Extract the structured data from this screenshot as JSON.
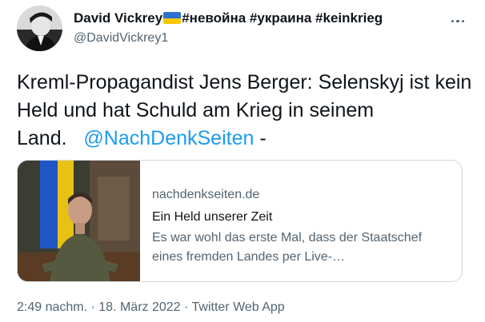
{
  "author": {
    "display_name": "David Vickrey",
    "display_name_suffix": "#невойна #украина #keinkrieg",
    "handle": "@DavidVickrey1",
    "avatar_icon": "profile-photo",
    "flag_icon": "ukraine-flag-icon"
  },
  "menu": {
    "icon": "more-options-icon"
  },
  "tweet": {
    "text": "Kreml-Propagandist Jens Berger: Selenskyj ist kein Held und hat Schuld am Krieg in seinem Land.",
    "mention": "@NachDenkSeiten",
    "trailing": " -"
  },
  "card": {
    "domain": "nachdenkseiten.de",
    "title": "Ein Held unserer Zeit",
    "description": "Es war wohl das erste Mal, dass der Staatschef eines fremden Landes per Live-…"
  },
  "meta": {
    "time": "2:49 nachm.",
    "separator": " · ",
    "date": "18. März 2022",
    "source": "Twitter Web App"
  },
  "colors": {
    "link": "#1d9bf0",
    "secondary_text": "#536471",
    "primary_text": "#0f1419",
    "border": "#cfd9de"
  }
}
